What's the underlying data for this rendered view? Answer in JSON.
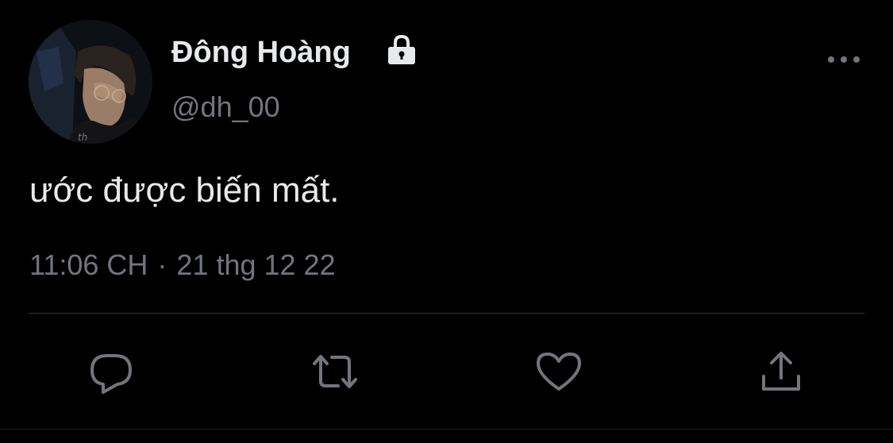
{
  "tweet": {
    "author": {
      "display_name": "Đông Hoàng",
      "handle": "@dh_00",
      "protected_icon": "lock-icon",
      "avatar": "profile-photo"
    },
    "text": "ước được biến mất.",
    "time": "11:06 CH",
    "separator": "·",
    "date": "21 thg 12 22",
    "menu_icon": "more-horizontal-icon",
    "actions": [
      {
        "icon": "reply-icon"
      },
      {
        "icon": "retweet-icon"
      },
      {
        "icon": "like-icon"
      },
      {
        "icon": "share-icon"
      }
    ]
  },
  "colors": {
    "background": "#000000",
    "primary_text": "#e7e9ea",
    "secondary_text": "#71767b",
    "divider": "#2f3336"
  }
}
